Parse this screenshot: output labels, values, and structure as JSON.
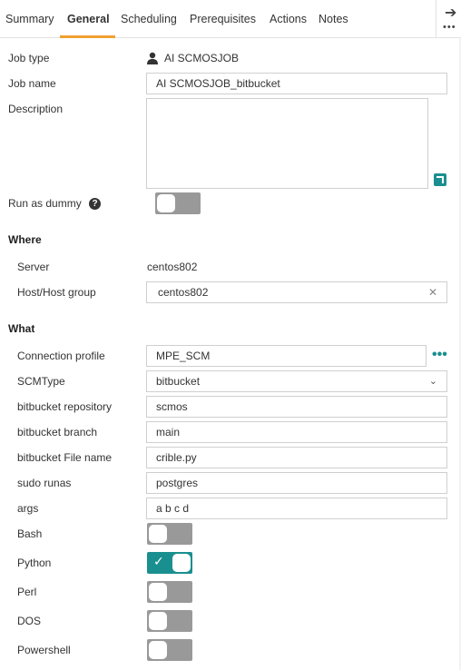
{
  "tabs": [
    "Summary",
    "General",
    "Scheduling",
    "Prerequisites",
    "Actions",
    "Notes"
  ],
  "active_tab": "General",
  "side": {
    "arrow_icon": "arrow-right-icon",
    "more_icon": "more-horizontal-icon"
  },
  "accent_color": "#1a8f8f",
  "general": {
    "job_type_label": "Job type",
    "job_type_value": "AI SCMOSJOB",
    "job_name_label": "Job name",
    "job_name_value": "AI SCMOSJOB_bitbucket",
    "description_label": "Description",
    "description_value": "",
    "run_as_dummy_label": "Run as dummy",
    "run_as_dummy": false,
    "help_glyph": "?"
  },
  "where": {
    "title": "Where",
    "server_label": "Server",
    "server_value": "centos802",
    "host_label": "Host/Host group",
    "host_value": "centos802"
  },
  "what": {
    "title": "What",
    "connection_profile_label": "Connection profile",
    "connection_profile_value": "MPE_SCM",
    "scmtype_label": "SCMType",
    "scmtype_value": "bitbucket",
    "repo_label": "bitbucket repository",
    "repo_value": "scmos",
    "branch_label": "bitbucket branch",
    "branch_value": "main",
    "file_label": "bitbucket File name",
    "file_value": "crible.py",
    "sudo_label": "sudo runas",
    "sudo_value": "postgres",
    "args_label": "args",
    "args_value": "a b c d",
    "bash_label": "Bash",
    "bash": false,
    "python_label": "Python",
    "python": true,
    "perl_label": "Perl",
    "perl": false,
    "dos_label": "DOS",
    "dos": false,
    "powershell_label": "Powershell",
    "powershell": false
  }
}
